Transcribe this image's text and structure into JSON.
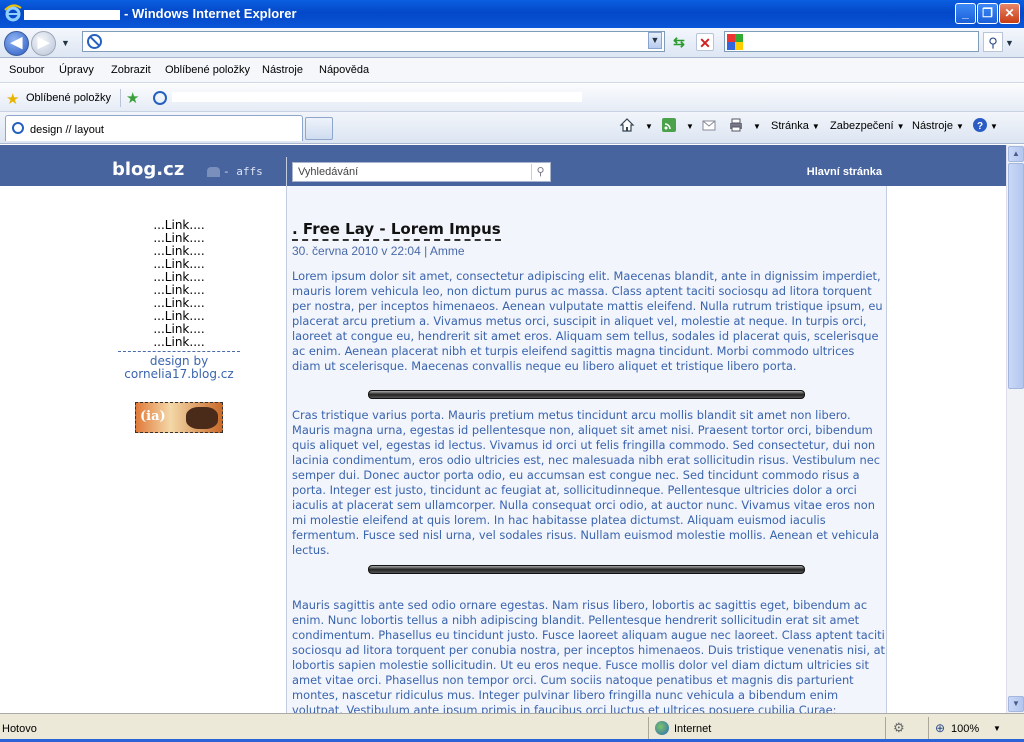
{
  "window": {
    "title": "- Windows Internet Explorer"
  },
  "nav": {
    "back_glyph": "◀",
    "forward_glyph": "▶",
    "address_value": "",
    "search_value": ""
  },
  "menu": {
    "items": [
      "Soubor",
      "Úpravy",
      "Zobrazit",
      "Oblíbené položky",
      "Nástroje",
      "Nápověda"
    ]
  },
  "favorites": {
    "label": "Oblíbené položky"
  },
  "tabs": {
    "active_label": "design // layout"
  },
  "commandbar": {
    "page_label": "Stránka",
    "security_label": "Zabezpečení",
    "tools_label": "Nástroje"
  },
  "site": {
    "logo": "blog.cz",
    "affs": "- affs",
    "search_placeholder": "Vyhledávání",
    "home_link": "Hlavní stránka"
  },
  "post": {
    "title": ". Free Lay - Lorem Impus",
    "meta": "30. června 2010 v 22:04 | Amme",
    "paragraphs": [
      "Lorem ipsum dolor sit amet, consectetur adipiscing elit. Maecenas blandit, ante in dignissim imperdiet, mauris lorem vehicula leo, non dictum purus ac massa. Class aptent taciti sociosqu ad litora torquent per nostra, per inceptos himenaeos. Aenean vulputate mattis eleifend. Nulla rutrum tristique ipsum, eu placerat arcu pretium a. Vivamus metus orci, suscipit in aliquet vel, molestie at neque. In turpis orci, laoreet at congue eu, hendrerit sit amet eros. Aliquam sem tellus, sodales id placerat quis, scelerisque ac enim. Aenean placerat nibh et turpis eleifend sagittis magna tincidunt. Morbi commodo ultrices diam ut scelerisque. Maecenas convallis neque eu libero aliquet et tristique libero porta.",
      "Cras tristique varius porta. Mauris pretium metus tincidunt arcu mollis blandit sit amet non libero. Mauris magna urna, egestas id pellentesque non, aliquet sit amet nisi. Praesent tortor orci, bibendum quis aliquet vel, egestas id lectus. Vivamus id orci ut felis fringilla commodo. Sed consectetur, dui non lacinia condimentum, eros odio ultricies est, nec malesuada nibh erat sollicitudin risus. Vestibulum nec semper dui. Donec auctor porta odio, eu accumsan est congue nec. Sed tincidunt commodo risus a porta. Integer est justo, tincidunt ac feugiat at, sollicitudinneque. Pellentesque ultricies dolor a orci iaculis at placerat sem ullamcorper. Nulla consequat orci odio, at auctor nunc. Vivamus vitae eros non mi molestie eleifend at quis lorem. In hac habitasse platea dictumst. Aliquam euismod iaculis fermentum. Fusce sed nisl urna, vel sodales risus. Nullam euismod molestie mollis. Aenean et vehicula lectus.",
      "Mauris sagittis ante sed odio ornare egestas. Nam risus libero, lobortis ac sagittis eget, bibendum ac enim. Nunc lobortis tellus a nibh adipiscing blandit. Pellentesque hendrerit sollicitudin erat sit amet condimentum. Phasellus eu tincidunt justo. Fusce laoreet aliquam augue nec laoreet. Class aptent taciti sociosqu ad litora torquent per conubia nostra, per inceptos himenaeos. Duis tristique venenatis nisi, at lobortis sapien molestie sollicitudin. Ut eu eros neque. Fusce mollis dolor vel diam dictum ultricies sit amet vitae orci. Phasellus non tempor orci. Cum sociis natoque penatibus et magnis dis parturient montes, nascetur ridiculus mus. Integer pulvinar libero fringilla nunc vehicula a bibendum enim volutpat. Vestibulum ante ipsum primis in faucibus orci luctus et ultrices posuere cubilia Curae;"
    ]
  },
  "sidebar": {
    "links": [
      "...Link....",
      "...Link....",
      "...Link....",
      "...Link....",
      "...Link....",
      "...Link....",
      "...Link....",
      "...Link....",
      "...Link....",
      "...Link...."
    ],
    "design_by_1": "design by",
    "design_by_2": "cornelia17.blog.cz",
    "banner_text": "ia"
  },
  "status": {
    "text": "Hotovo",
    "zone": "Internet",
    "zoom": "100%"
  },
  "colors": {
    "site_header": "#47649e",
    "post_text": "#3a64ae",
    "titlebar": "#0348c8"
  }
}
